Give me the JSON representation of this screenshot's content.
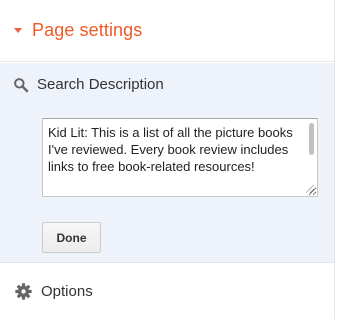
{
  "header": {
    "title": "Page settings",
    "accent_color": "#f05a28",
    "caret_icon": "caret-down-icon"
  },
  "search_description": {
    "label": "Search Description",
    "icon": "search-icon",
    "value": "Kid Lit: This is a list of all the picture books I've reviewed. Every book review includes links to free book-related resources!",
    "done_label": "Done",
    "background_color": "#eef2fb"
  },
  "options": {
    "label": "Options",
    "icon": "gear-icon"
  }
}
